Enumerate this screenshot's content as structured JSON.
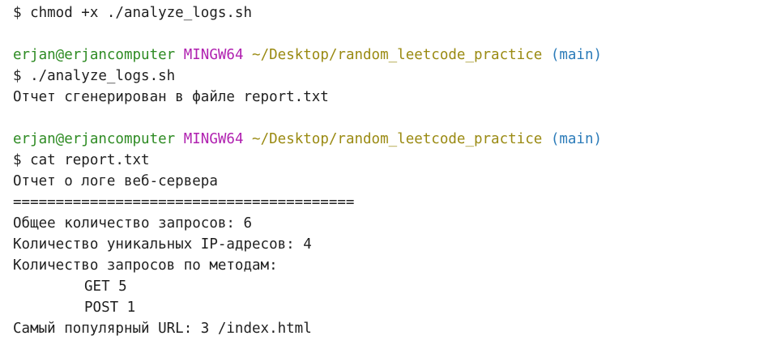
{
  "terminal": {
    "cmd1": "$ chmod +x ./analyze_logs.sh",
    "prompt1": {
      "user": "erjan@erjancomputer",
      "env": "MINGW64",
      "path": "~/Desktop/random_leetcode_practice",
      "branch": "(main)"
    },
    "cmd2": "$ ./analyze_logs.sh",
    "out1": "Отчет сгенерирован в файле report.txt",
    "prompt2": {
      "user": "erjan@erjancomputer",
      "env": "MINGW64",
      "path": "~/Desktop/random_leetcode_practice",
      "branch": "(main)"
    },
    "cmd3": "$ cat report.txt",
    "report": {
      "title": "Отчет о логе веб-сервера",
      "separator": "========================================",
      "total": "Общее количество запросов: 6",
      "unique_ips": "Количество уникальных IP-адресов: 4",
      "methods_header": "Количество запросов по методам:",
      "method_get": "GET 5",
      "method_post": "POST 1",
      "popular_url": "Самый популярный URL: 3 /index.html"
    }
  },
  "colors": {
    "user": "#2e8b23",
    "env": "#b021b0",
    "path": "#9a8a12",
    "branch": "#2b7bb9",
    "text": "#1f1f1f"
  }
}
